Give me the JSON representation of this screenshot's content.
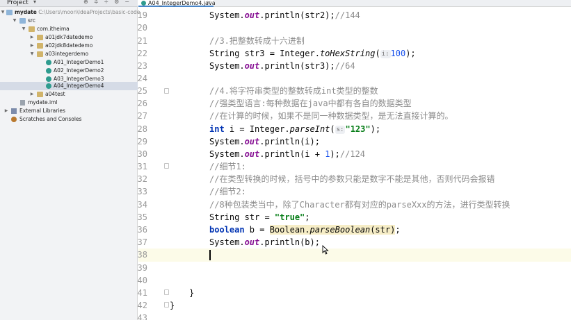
{
  "project_panel": {
    "title": "Project",
    "tree": [
      {
        "label": "mydate",
        "path": "C:\\Users\\moon\\IdeaProjects\\basic-code",
        "icon": "module-folder-icon"
      },
      {
        "label": "src",
        "icon": "source-folder-icon"
      },
      {
        "label": "com.itheima",
        "icon": "package-icon"
      },
      {
        "label": "a01jdk7datedemo",
        "icon": "package-icon"
      },
      {
        "label": "a02jdk8datedemo",
        "icon": "package-icon"
      },
      {
        "label": "a03integerdemo",
        "icon": "package-icon"
      },
      {
        "label": "A01_IntegerDemo1",
        "icon": "java-class-icon"
      },
      {
        "label": "A02_IntegerDemo2",
        "icon": "java-class-icon"
      },
      {
        "label": "A03_IntegerDemo3",
        "icon": "java-class-icon"
      },
      {
        "label": "A04_IntegerDemo4",
        "icon": "java-class-icon",
        "selected": true
      },
      {
        "label": "a04test",
        "icon": "package-icon"
      },
      {
        "label": "mydate.iml",
        "icon": "iml-file-icon"
      },
      {
        "label": "External Libraries",
        "icon": "library-icon"
      },
      {
        "label": "Scratches and Consoles",
        "icon": "scratches-icon"
      }
    ]
  },
  "editor": {
    "active_tab": "A04_IntegerDemo4.java",
    "line_numbers": [
      "19",
      "20",
      "21",
      "22",
      "23",
      "24",
      "25",
      "26",
      "27",
      "28",
      "29",
      "30",
      "31",
      "32",
      "33",
      "34",
      "35",
      "36",
      "37",
      "38",
      "39",
      "40",
      "41",
      "42",
      "43"
    ],
    "code": {
      "l19_a": "System.",
      "l19_b": "out",
      "l19_c": ".println(str2);",
      "l19_cmt": "//144",
      "l21": "//3.把整数转成十六进制",
      "l22_a": "String str3 = Integer.",
      "l22_b": "toHexString",
      "l22_c": "(",
      "l22_hint": "i:",
      "l22_num": "100",
      "l22_d": ");",
      "l23_a": "System.",
      "l23_b": "out",
      "l23_c": ".println(str3);",
      "l23_cmt": "//64",
      "l25": "//4.将字符串类型的整数转成int类型的整数",
      "l26": "//强类型语言:每种数据在java中都有各自的数据类型",
      "l27": "//在计算的时候，如果不是同一种数据类型，是无法直接计算的。",
      "l28_kw": "int",
      "l28_a": " i = Integer.",
      "l28_b": "parseInt",
      "l28_c": "(",
      "l28_hint": "s:",
      "l28_str": "\"123\"",
      "l28_d": ");",
      "l29_a": "System.",
      "l29_b": "out",
      "l29_c": ".println(i);",
      "l30_a": "System.",
      "l30_b": "out",
      "l30_c": ".println(i + ",
      "l30_num": "1",
      "l30_d": ");",
      "l30_cmt": "//124",
      "l31": "//细节1:",
      "l32": "//在类型转换的时候，括号中的参数只能是数字不能是其他，否则代码会报错",
      "l33": "//细节2:",
      "l34": "//8种包装类当中，除了Character都有对应的parseXxx的方法，进行类型转换",
      "l35_a": "String str = ",
      "l35_str": "\"true\"",
      "l35_d": ";",
      "l36_kw": "boolean",
      "l36_a": " b = ",
      "l36_b": "Boolean.",
      "l36_c": "parseBoolean",
      "l36_d": "(str)",
      "l36_e": ";",
      "l37_a": "System.",
      "l37_b": "out",
      "l37_c": ".println(b);",
      "l41": "}",
      "l42": "}"
    }
  }
}
